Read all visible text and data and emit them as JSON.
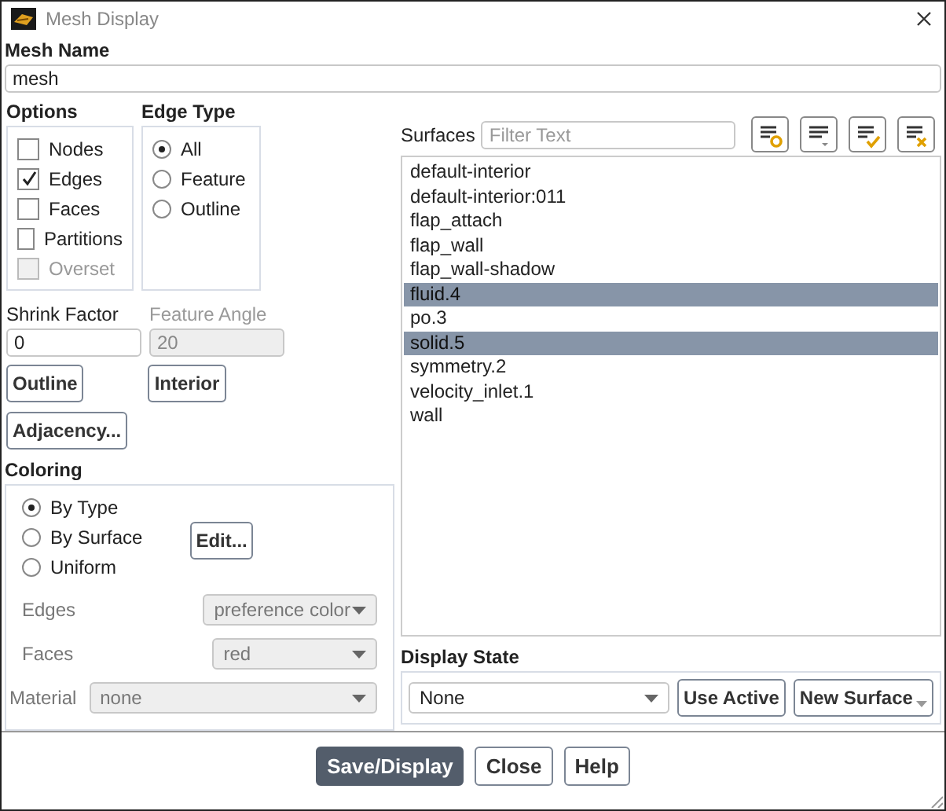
{
  "window": {
    "title": "Mesh Display"
  },
  "mesh_name": {
    "label": "Mesh Name",
    "value": "mesh"
  },
  "options": {
    "title": "Options",
    "items": [
      {
        "label": "Nodes",
        "checked": false,
        "disabled": false
      },
      {
        "label": "Edges",
        "checked": true,
        "disabled": false
      },
      {
        "label": "Faces",
        "checked": false,
        "disabled": false
      },
      {
        "label": "Partitions",
        "checked": false,
        "disabled": false
      },
      {
        "label": "Overset",
        "checked": false,
        "disabled": true
      }
    ]
  },
  "edge_type": {
    "title": "Edge Type",
    "items": [
      {
        "label": "All",
        "selected": true
      },
      {
        "label": "Feature",
        "selected": false
      },
      {
        "label": "Outline",
        "selected": false
      }
    ]
  },
  "shrink_factor": {
    "label": "Shrink Factor",
    "value": "0"
  },
  "feature_angle": {
    "label": "Feature Angle",
    "value": "20",
    "disabled": true
  },
  "buttons_left": [
    [
      "Outline",
      "Interior"
    ],
    [
      "Adjacency..."
    ]
  ],
  "coloring": {
    "title": "Coloring",
    "items": [
      {
        "label": "By Type",
        "selected": true
      },
      {
        "label": "By Surface",
        "selected": false
      },
      {
        "label": "Uniform",
        "selected": false
      }
    ],
    "edit_button": "Edit...",
    "fields": [
      {
        "label": "Edges",
        "value": "preference color",
        "kind": "short"
      },
      {
        "label": "Faces",
        "value": "red",
        "kind": "narrow"
      },
      {
        "label": "Material",
        "value": "none",
        "kind": "wide"
      }
    ]
  },
  "surfaces": {
    "label": "Surfaces",
    "placeholder": "Filter Text",
    "tools": [
      {
        "kind": "circle"
      },
      {
        "kind": "caret"
      },
      {
        "kind": "check"
      },
      {
        "kind": "cross"
      }
    ],
    "items": [
      {
        "label": "default-interior",
        "selected": false
      },
      {
        "label": "default-interior:011",
        "selected": false
      },
      {
        "label": "flap_attach",
        "selected": false
      },
      {
        "label": "flap_wall",
        "selected": false
      },
      {
        "label": "flap_wall-shadow",
        "selected": false
      },
      {
        "label": "fluid.4",
        "selected": true
      },
      {
        "label": "po.3",
        "selected": false
      },
      {
        "label": "solid.5",
        "selected": true
      },
      {
        "label": "symmetry.2",
        "selected": false
      },
      {
        "label": "velocity_inlet.1",
        "selected": false
      },
      {
        "label": "wall",
        "selected": false
      }
    ]
  },
  "display_state": {
    "title": "Display State",
    "value": "None",
    "buttons": [
      "Use Active",
      "New Surface"
    ]
  },
  "footer_buttons": [
    {
      "label": "Save/Display",
      "primary": true
    },
    {
      "label": "Close",
      "primary": false
    },
    {
      "label": "Help",
      "primary": false
    }
  ]
}
